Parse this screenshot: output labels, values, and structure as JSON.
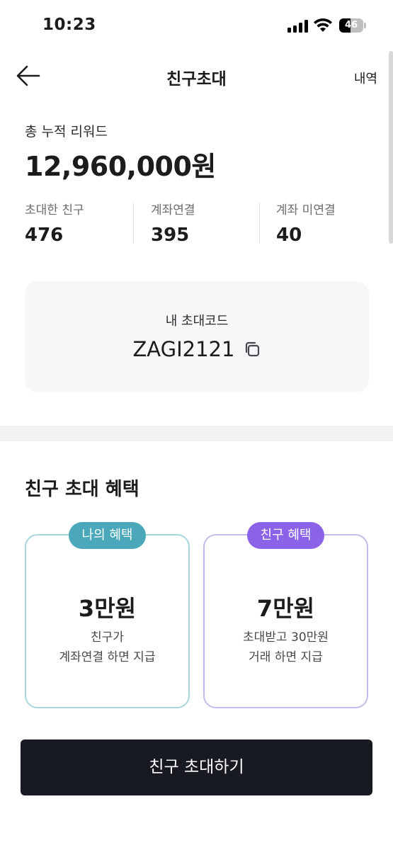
{
  "status_bar": {
    "time": "10:23",
    "battery_percent": 46,
    "battery_label": "46"
  },
  "nav": {
    "title": "친구초대",
    "history_label": "내역"
  },
  "reward": {
    "label": "총 누적 리워드",
    "amount": "12,960,000원"
  },
  "stats": [
    {
      "label": "초대한 친구",
      "value": "476"
    },
    {
      "label": "계좌연결",
      "value": "395"
    },
    {
      "label": "계좌 미연결",
      "value": "40"
    }
  ],
  "invite_code": {
    "label": "내 초대코드",
    "code": "ZAGI2121"
  },
  "benefits": {
    "title": "친구 초대 혜택",
    "mine": {
      "badge": "나의 혜택",
      "amount": "3만원",
      "desc_line1": "친구가",
      "desc_line2": "계좌연결 하면 지급"
    },
    "friend": {
      "badge": "친구 혜택",
      "amount": "7만원",
      "desc_line1": "초대받고 30만원",
      "desc_line2": "거래 하면 지급"
    }
  },
  "cta": {
    "label": "친구 초대하기"
  },
  "colors": {
    "mine_accent": "#4aa8ba",
    "friend_accent": "#8a63e8",
    "button_bg": "#181a21"
  }
}
